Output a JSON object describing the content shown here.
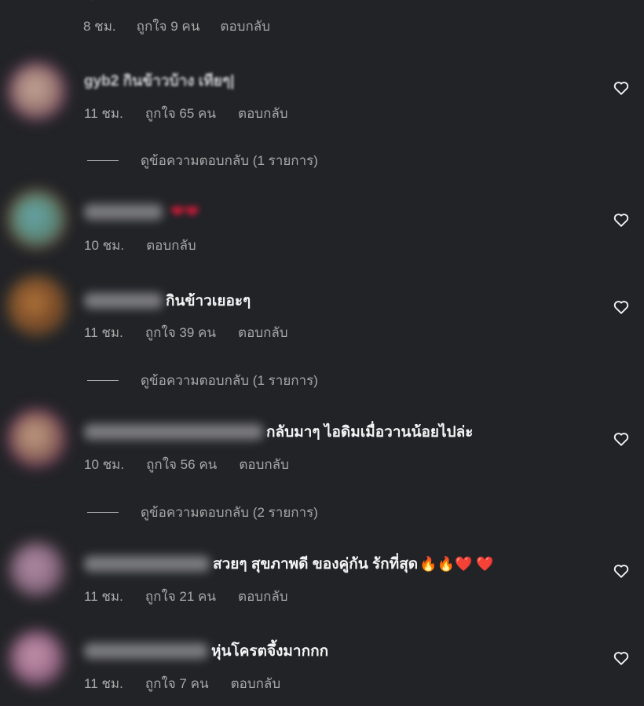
{
  "top_comment": {
    "time": "8 ชม.",
    "likes": "ถูกใจ 9 คน",
    "reply": "ตอบกลับ"
  },
  "comments": [
    {
      "text": "gyb2 กินข้าวบ้าง เทียๆ|",
      "time": "11 ชม.",
      "likes": "ถูกใจ 65 คน",
      "reply": "ตอบกลับ",
      "view_replies": "ดูข้อความตอบกลับ (1 รายการ)"
    },
    {
      "text": "",
      "time": "10 ชม.",
      "likes": "",
      "reply": "ตอบกลับ"
    },
    {
      "text": "กินข้าวเยอะๆ",
      "time": "11 ชม.",
      "likes": "ถูกใจ 39 คน",
      "reply": "ตอบกลับ",
      "view_replies": "ดูข้อความตอบกลับ (1 รายการ)"
    },
    {
      "text": "กลับมาๆ ไอดิมเมื่อวานน้อยไปล่ะ",
      "time": "10 ชม.",
      "likes": "ถูกใจ 56 คน",
      "reply": "ตอบกลับ",
      "view_replies": "ดูข้อความตอบกลับ (2 รายการ)"
    },
    {
      "text": "สวยๆ สุขภาพดี ของคู่กัน รักที่สุด",
      "emoji": "🔥🔥❤️ ❤️",
      "time": "11 ชม.",
      "likes": "ถูกใจ 21 คน",
      "reply": "ตอบกลับ"
    },
    {
      "text": "หุ่นโครตจึ้งมากกก",
      "time": "11 ชม.",
      "likes": "ถูกใจ 7 คน",
      "reply": "ตอบกลับ"
    }
  ],
  "colors": {
    "background": "#222327",
    "text": "#f5f5f5",
    "meta": "#a8a8a8",
    "heart": "#e0193a"
  },
  "icons": [
    "heart-outline-icon",
    "heart-emoji-icon",
    "fire-emoji-icon"
  ]
}
